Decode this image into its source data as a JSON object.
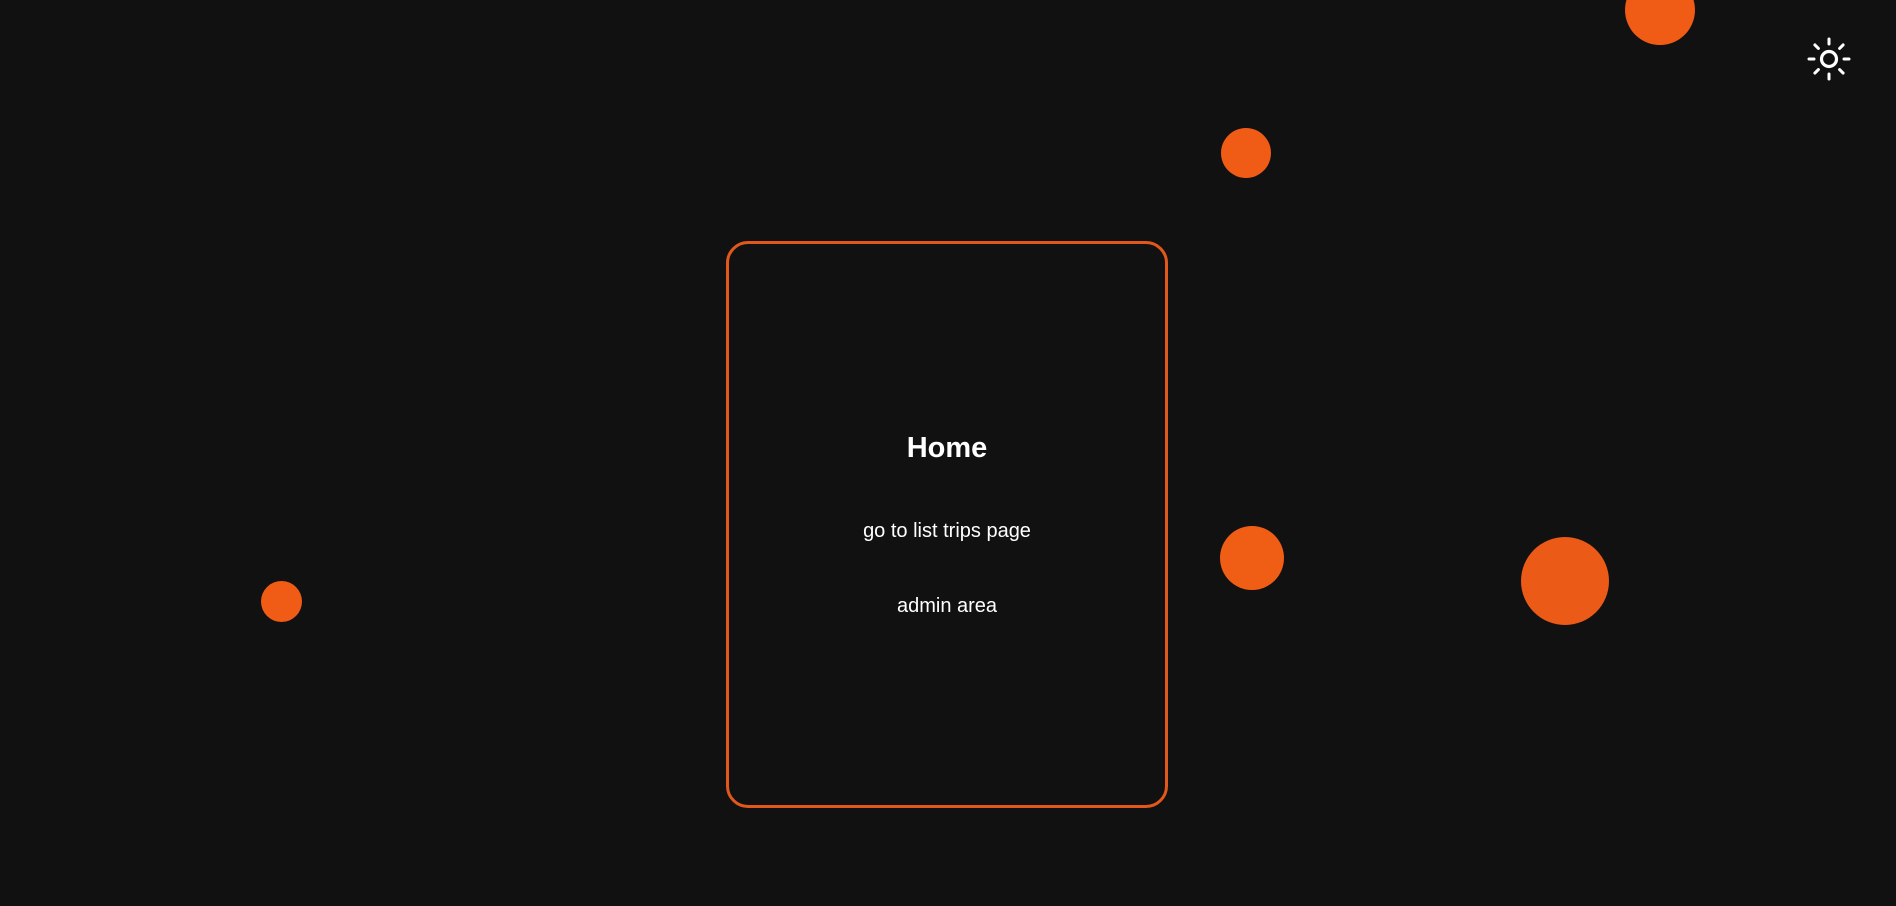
{
  "theme_toggle": {
    "icon": "sun-icon"
  },
  "card": {
    "title": "Home",
    "links": [
      {
        "label": "go to list trips page"
      },
      {
        "label": "admin area"
      }
    ]
  },
  "colors": {
    "background": "#111111",
    "accent": "#f05c15",
    "card_border": "#e2581b",
    "text": "#ffffff"
  }
}
